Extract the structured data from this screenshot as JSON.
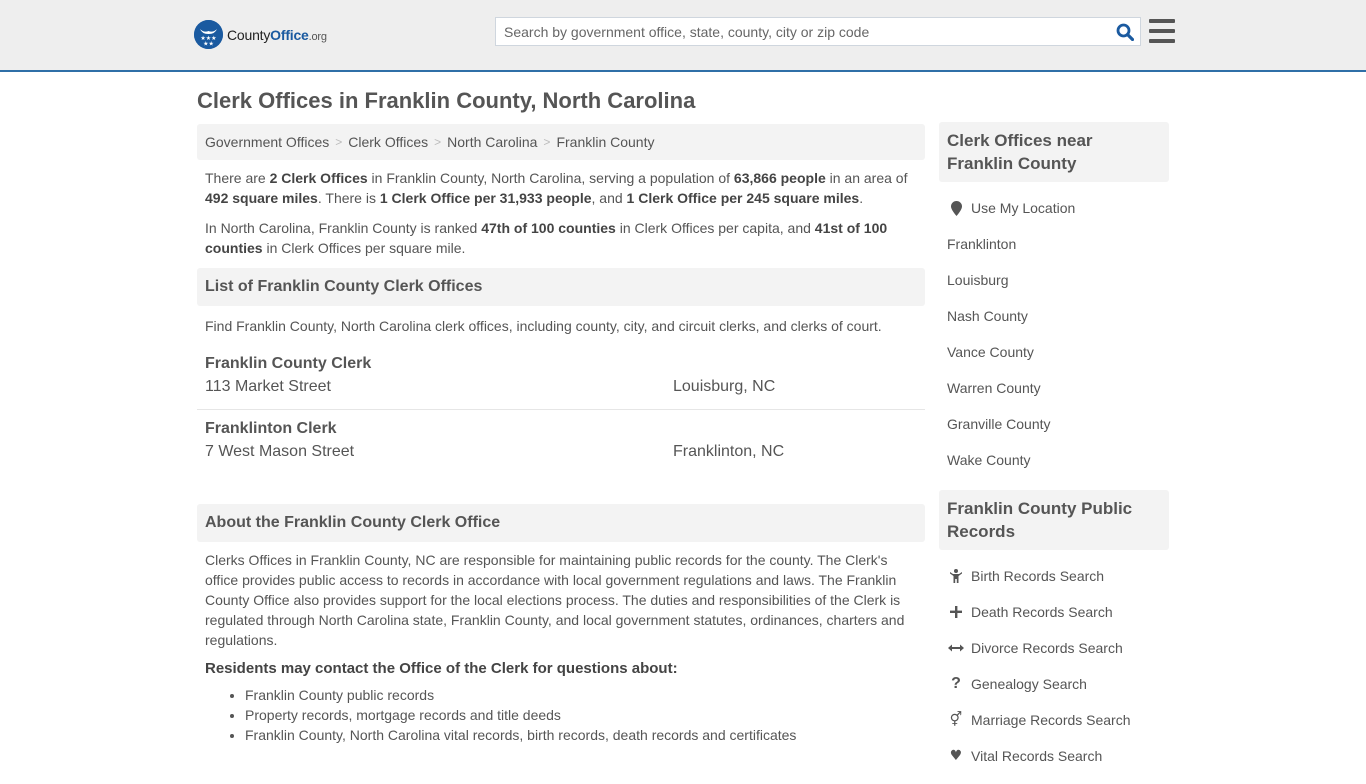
{
  "header": {
    "logo": {
      "prefix": "County",
      "brand": "Office",
      "tld": ".org"
    },
    "search_placeholder": "Search by government office, state, county, city or zip code",
    "search_value": "",
    "colors": {
      "accent": "#2f6fa7",
      "brand": "#1a5aa0",
      "header_bg": "#eeeeee"
    }
  },
  "page_title": "Clerk Offices in Franklin County, North Carolina",
  "breadcrumb": [
    "Government Offices",
    "Clerk Offices",
    "North Carolina",
    "Franklin County"
  ],
  "intro": {
    "p1": [
      {
        "t": "There are ",
        "b": false
      },
      {
        "t": "2 Clerk Offices",
        "b": true
      },
      {
        "t": " in Franklin County, North Carolina, serving a population of ",
        "b": false
      },
      {
        "t": "63,866 people",
        "b": true
      },
      {
        "t": " in an area of ",
        "b": false
      },
      {
        "t": "492 square miles",
        "b": true
      },
      {
        "t": ". There is ",
        "b": false
      },
      {
        "t": "1 Clerk Office per 31,933 people",
        "b": true
      },
      {
        "t": ", and ",
        "b": false
      },
      {
        "t": "1 Clerk Office per 245 square miles",
        "b": true
      },
      {
        "t": ".",
        "b": false
      }
    ],
    "p2": [
      {
        "t": "In North Carolina, Franklin County is ranked ",
        "b": false
      },
      {
        "t": "47th of 100 counties",
        "b": true
      },
      {
        "t": " in Clerk Offices per capita, and ",
        "b": false
      },
      {
        "t": "41st of 100 counties",
        "b": true
      },
      {
        "t": " in Clerk Offices per square mile.",
        "b": false
      }
    ]
  },
  "list_section": {
    "title": "List of Franklin County Clerk Offices",
    "description": "Find Franklin County, North Carolina clerk offices, including county, city, and circuit clerks, and clerks of court.",
    "offices": [
      {
        "name": "Franklin County Clerk",
        "address": "113 Market Street",
        "city": "Louisburg, NC"
      },
      {
        "name": "Franklinton Clerk",
        "address": "7 West Mason Street",
        "city": "Franklinton, NC"
      }
    ]
  },
  "about_section": {
    "title": "About the Franklin County Clerk Office",
    "text": "Clerks Offices in Franklin County, NC are responsible for maintaining public records for the county. The Clerk's office provides public access to records in accordance with local government regulations and laws. The Franklin County Office also provides support for the local elections process. The duties and responsibilities of the Clerk is regulated through North Carolina state, Franklin County, and local government statutes, ordinances, charters and regulations.",
    "subheading": "Residents may contact the Office of the Clerk for questions about:",
    "items": [
      "Franklin County public records",
      "Property records, mortgage records and title deeds",
      "Franklin County, North Carolina vital records, birth records, death records and certificates"
    ]
  },
  "sidebar": {
    "nearby": {
      "title": "Clerk Offices near Franklin County",
      "use_location": "Use My Location",
      "links": [
        "Franklinton",
        "Louisburg",
        "Nash County",
        "Vance County",
        "Warren County",
        "Granville County",
        "Wake County"
      ]
    },
    "records": {
      "title": "Franklin County Public Records",
      "links": [
        {
          "label": "Birth Records Search",
          "icon": "child-icon",
          "glyph": "†"
        },
        {
          "label": "Death Records Search",
          "icon": "cross-icon",
          "glyph": "✚"
        },
        {
          "label": "Divorce Records Search",
          "icon": "arrows-horizontal-icon",
          "glyph": "↔"
        },
        {
          "label": "Genealogy Search",
          "icon": "question-icon",
          "glyph": "?"
        },
        {
          "label": "Marriage Records Search",
          "icon": "venus-mars-icon",
          "glyph": "⚥"
        },
        {
          "label": "Vital Records Search",
          "icon": "heartbeat-icon",
          "glyph": "♥"
        }
      ]
    }
  }
}
